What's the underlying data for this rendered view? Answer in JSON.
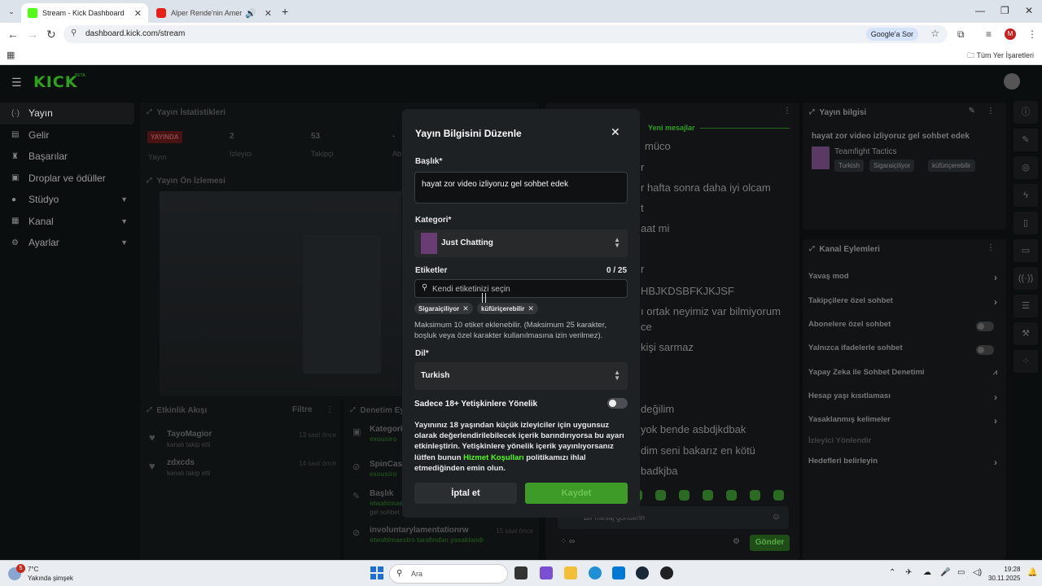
{
  "browser": {
    "tabs": [
      {
        "title": "Stream - Kick Dashboard",
        "active": true
      },
      {
        "title": "Alper Rende'nin Amerikan F",
        "active": false
      }
    ],
    "url": "dashboard.kick.com/stream",
    "google_btn": "Google'a Sor",
    "bookmark_folder": "Tüm Yer İşaretleri",
    "profile_initial": "M"
  },
  "app": {
    "logo": "KICK",
    "logo_tag": "BETA",
    "sidebar": [
      {
        "label": "Yayın",
        "icon": "(·)",
        "active": true
      },
      {
        "label": "Gelir",
        "icon": "▤"
      },
      {
        "label": "Başarılar",
        "icon": "🏆"
      },
      {
        "label": "Droplar ve ödüller",
        "icon": "▣"
      },
      {
        "label": "Stüdyo",
        "icon": "●",
        "chevron": true
      },
      {
        "label": "Kanal",
        "icon": "▦",
        "chevron": true
      },
      {
        "label": "Ayarlar",
        "icon": "⚙",
        "chevron": true
      }
    ],
    "stats": {
      "title": "Yayın İstatistikleri",
      "live": "YAYINDA",
      "live_label": "Yayın",
      "viewers": "2",
      "viewers_label": "İzleyici",
      "followers": "53",
      "followers_label": "Takipçi",
      "extra": "-",
      "extra_label": "Ab"
    },
    "preview_title": "Yayın Ön İzlemesi",
    "activity": {
      "title": "Etkinlik Akışı",
      "filter": "Filtre",
      "items": [
        {
          "name": "TayoMagior",
          "sub": "kanalı takip etti",
          "time": "13 saat önce"
        },
        {
          "name": "zdxcds",
          "sub": "kanalı takip etti",
          "time": "14 saat önce"
        }
      ]
    },
    "moderation": {
      "title": "Denetim Ey",
      "items": [
        {
          "name": "Kategori",
          "sub": "exousiro"
        },
        {
          "name": "SpinCasi",
          "sub": "exousiro"
        },
        {
          "name": "Başlık",
          "sub": "etwahlmae",
          "sub2": "gel sohbet"
        },
        {
          "name": "involuntarylamentationrw",
          "sub": "etwahlmaestro tarafından yasaklandı",
          "time": "15 saat önce"
        }
      ]
    },
    "chat": {
      "new_messages": "Yeni mesajlar",
      "lines": [
        "müco",
        "r",
        "r hafta sonra daha iyi olcam",
        "t",
        "aat mi",
        "r",
        "HBJKDSBFKJKJSF",
        "ı ortak neyimiz var bilmiyorum",
        "ce",
        "kişi sarmaz",
        "değilim",
        "yok bende asbdjkdbak",
        "dim seni bakarız en kötü",
        "badkjba"
      ],
      "input_placeholder": "Bir mesaj gönderin",
      "send": "Gönder"
    },
    "stream_info": {
      "title": "Yayın bilgisi",
      "stream_title": "hayat zor video izliyoruz gel sohbet edek",
      "category": "Teamfight Tactics",
      "tags": [
        "Turkish",
        "Sigaraiçiliyor",
        "küfüriçerebilir"
      ]
    },
    "channel_actions": {
      "title": "Kanal Eylemleri",
      "items": [
        {
          "label": "Yavaş mod",
          "type": "arrow"
        },
        {
          "label": "Takipçilere özel sohbet",
          "type": "arrow"
        },
        {
          "label": "Abonelere özel sohbet",
          "type": "toggle"
        },
        {
          "label": "Yalnızca ifadelerle sohbet",
          "type": "toggle"
        },
        {
          "label": "Yapay Zeka ile Sohbet Denetimi",
          "type": "chart"
        },
        {
          "label": "Hesap yaşı kısıtlaması",
          "type": "arrow"
        },
        {
          "label": "Yasaklanmış kelimeler",
          "type": "arrow"
        },
        {
          "label": "İzleyici Yönlendir",
          "type": "none"
        },
        {
          "label": "Hedefleri belirleyin",
          "type": "arrow"
        }
      ]
    }
  },
  "modal": {
    "title": "Yayın Bilgisini Düzenle",
    "title_label": "Başlık*",
    "title_value": "hayat zor video izliyoruz gel sohbet edek",
    "category_label": "Kategori*",
    "category_value": "Just Chatting",
    "tags_label": "Etiketler",
    "tags_count": "0 / 25",
    "tag_search_placeholder": "Kendi etiketinizi seçin",
    "tags": [
      "Sigaraiçiliyor",
      "küfüriçerebilir"
    ],
    "tags_help": "Maksimum 10 etiket eklenebilir. (Maksimum 25 karakter, boşluk veya özel karakter kullanılmasına izin verilmez).",
    "language_label": "Dil*",
    "language_value": "Turkish",
    "adult_label": "Sadece 18+ Yetişkinlere Yönelik",
    "adult_enabled": false,
    "warning_pre": "Yayınınız 18 yaşından küçük izleyiciler için uygunsuz olarak değerlendirilebilecek içerik barındırıyorsa bu ayarı etkinleştirin. Yetişkinlere yönelik içerik yayınlıyorsanız lütfen bunun ",
    "warning_link": "Hizmet Koşulları",
    "warning_post": " politikamızı ihlal etmediğinden emin olun.",
    "cancel": "İptal et",
    "save": "Kaydet"
  },
  "taskbar": {
    "weather_temp": "7°C",
    "weather_cond": "Yakında şimşek",
    "weather_badge": "5",
    "search": "Ara",
    "time": "19:28",
    "date": "30.11.2025"
  }
}
